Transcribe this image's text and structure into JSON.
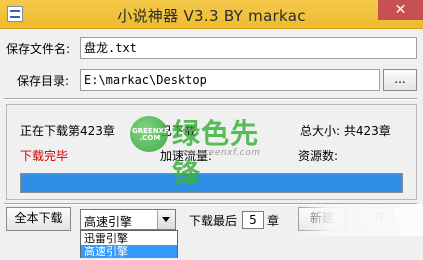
{
  "window": {
    "title": "小说神器  V3.3   BY markac",
    "close_label": "✕"
  },
  "form": {
    "save_name_label": "保存文件名:",
    "save_name_value": "盘龙.txt",
    "save_dir_label": "保存目录:",
    "save_dir_value": "E:\\markac\\Desktop",
    "browse_label": "..."
  },
  "status": {
    "downloading": "正在下载第423章",
    "downloaded": "已下载",
    "total": "总大小: 共423章",
    "done": "下载完毕",
    "speed": "加速流量:",
    "resources": "资源数:",
    "progress_fraction": 1.0,
    "progress_color": "#2f8fe6",
    "done_color": "#cc0000"
  },
  "watermark": {
    "logo_text": "GREENXF .COM",
    "brand": "绿色先锋",
    "url": "www.greenxf.com"
  },
  "toolbar": {
    "download_all": "全本下载",
    "engine_selected": "高速引擎",
    "engine_options": [
      "迅雷引擎",
      "高速引擎"
    ],
    "download_last_prefix": "下载最后",
    "download_last_value": "5",
    "download_last_suffix": "章",
    "btn_a": "新建",
    "btn_b": "停止"
  }
}
